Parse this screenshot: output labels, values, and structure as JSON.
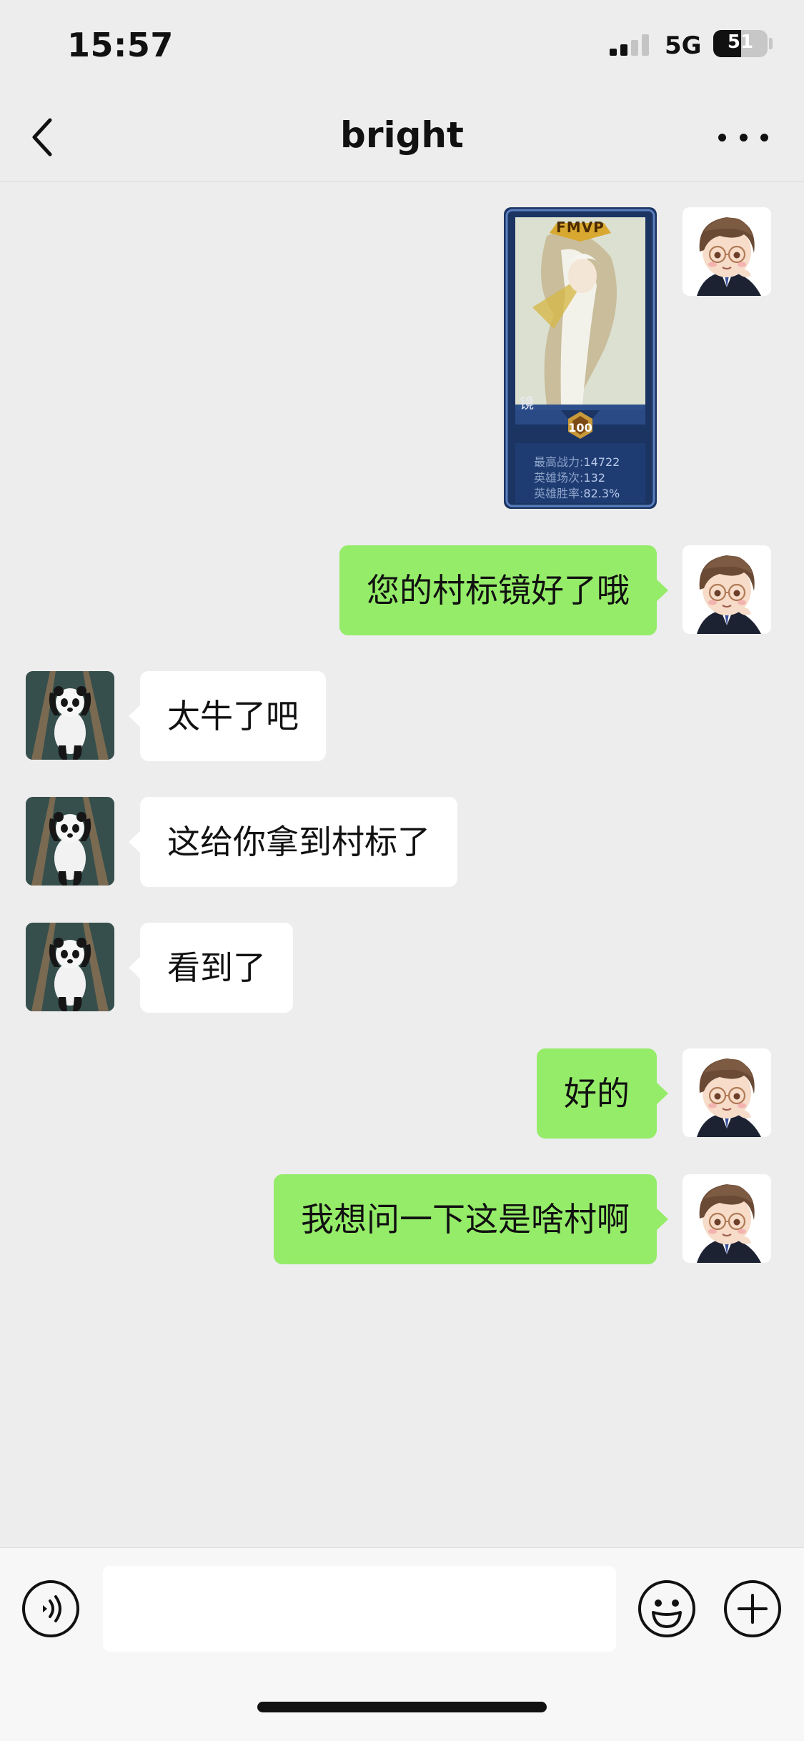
{
  "status_bar": {
    "time": "15:57",
    "network": "5G",
    "battery": "51",
    "battery_level_percent": 51
  },
  "nav": {
    "title": "bright",
    "back_icon": "chevron-left-icon",
    "more_icon": "more-dots-icon"
  },
  "messages": [
    {
      "side": "me",
      "type": "image",
      "card": {
        "badge": "FMVP",
        "name": "镜",
        "level": "100",
        "stats": [
          {
            "label": "最高战力:",
            "value": "14722"
          },
          {
            "label": "英雄场次:",
            "value": "132"
          },
          {
            "label": "英雄胜率:",
            "value": "82.3%"
          }
        ]
      }
    },
    {
      "side": "me",
      "type": "text",
      "text": "您的村标镜好了哦"
    },
    {
      "side": "other",
      "type": "text",
      "text": "太牛了吧"
    },
    {
      "side": "other",
      "type": "text",
      "text": "这给你拿到村标了"
    },
    {
      "side": "other",
      "type": "text",
      "text": "看到了"
    },
    {
      "side": "me",
      "type": "text",
      "text": "好的"
    },
    {
      "side": "me",
      "type": "text",
      "text": "我想问一下这是啥村啊"
    }
  ],
  "input_bar": {
    "value": "",
    "placeholder": "",
    "voice_icon": "voice-icon",
    "emoji_icon": "emoji-icon",
    "plus_icon": "plus-icon"
  },
  "colors": {
    "background": "#ededed",
    "my_bubble": "#95ec69",
    "other_bubble": "#ffffff"
  }
}
